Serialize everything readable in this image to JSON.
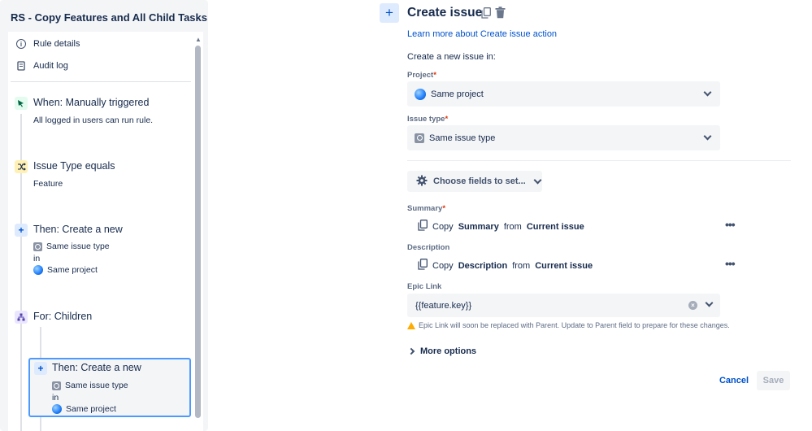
{
  "rule": {
    "title": "RS - Copy Features and All Child Tasks"
  },
  "nav": {
    "rule_details": "Rule details",
    "audit_log": "Audit log"
  },
  "steps": {
    "trigger": {
      "title": "When: Manually triggered",
      "sub": "All logged in users can run rule."
    },
    "condition": {
      "title": "Issue Type equals",
      "sub": "Feature"
    },
    "action1": {
      "title": "Then: Create a new",
      "issue_type": "Same issue type",
      "in": "in",
      "project": "Same project"
    },
    "branch": {
      "title": "For: Children"
    },
    "action2": {
      "title": "Then: Create a new",
      "issue_type": "Same issue type",
      "in": "in",
      "project": "Same project"
    }
  },
  "panel": {
    "title": "Create issue",
    "learn_more": "Learn more about Create issue action",
    "intro": "Create a new issue in:",
    "project": {
      "label": "Project",
      "required": "*",
      "value": "Same project"
    },
    "issue_type": {
      "label": "Issue type",
      "required": "*",
      "value": "Same issue type"
    },
    "choose_fields": "Choose fields to set...",
    "summary": {
      "label": "Summary",
      "required": "*",
      "copy": "Copy",
      "field": "Summary",
      "from": "from",
      "source": "Current issue"
    },
    "description": {
      "label": "Description",
      "copy": "Copy",
      "field": "Description",
      "from": "from",
      "source": "Current issue"
    },
    "epic_link": {
      "label": "Epic Link",
      "value": "{{feature.key}}",
      "warning": "Epic Link will soon be replaced with Parent. Update to Parent field to prepare for these changes."
    },
    "more_options": "More options",
    "cancel": "Cancel",
    "save": "Save",
    "more_dots": "•••"
  },
  "colors": {
    "accent": "#0052cc",
    "selected_border": "#4c9aff",
    "required": "#de350b",
    "warning": "#ffab00"
  }
}
